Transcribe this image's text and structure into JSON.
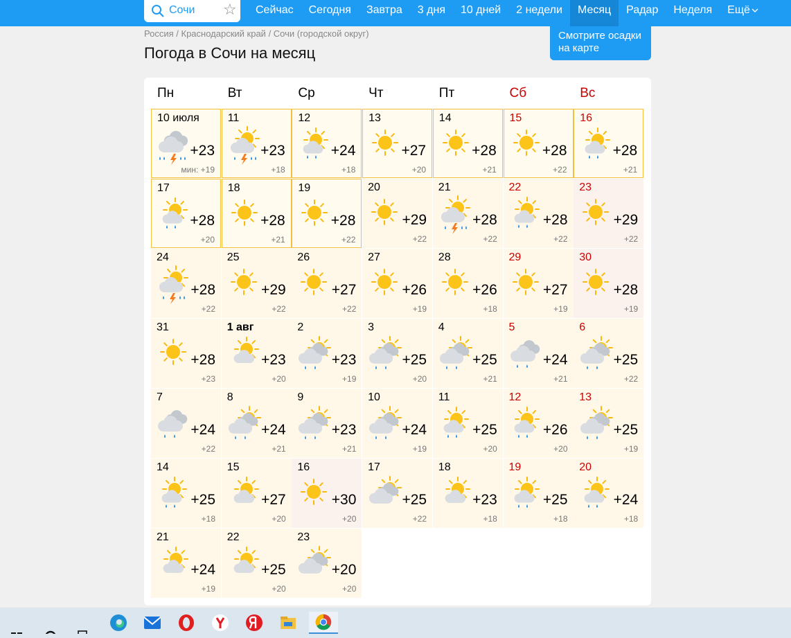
{
  "search": {
    "value": "Сочи"
  },
  "nav": {
    "items": [
      "Сейчас",
      "Сегодня",
      "Завтра",
      "3 дня",
      "10 дней",
      "2 недели",
      "Месяц",
      "Радар",
      "Неделя",
      "Ещё"
    ]
  },
  "promo": {
    "line1": "Смотрите осадки",
    "line2": "на карте"
  },
  "breadcrumbs": [
    "Россия",
    "Краснодарский край",
    "Сочи (городской округ)"
  ],
  "page_title": "Погода в Сочи на месяц",
  "weekdays": [
    "Пн",
    "Вт",
    "Ср",
    "Чт",
    "Пт",
    "Сб",
    "Вс"
  ],
  "min_prefix": "мин:",
  "days": [
    {
      "date": "10 июля",
      "icon": "cloud-thunder-rain-icon",
      "max": "+23",
      "min": "+19"
    },
    {
      "date": "11",
      "icon": "sun-cloud-thunder-rain-icon",
      "max": "+23",
      "min": "+18"
    },
    {
      "date": "12",
      "icon": "sun-cloud-rain-icon",
      "max": "+24",
      "min": "+18"
    },
    {
      "date": "13",
      "icon": "sun-icon",
      "max": "+27",
      "min": "+20"
    },
    {
      "date": "14",
      "icon": "sun-icon",
      "max": "+28",
      "min": "+21"
    },
    {
      "date": "15",
      "icon": "sun-icon",
      "max": "+28",
      "min": "+22"
    },
    {
      "date": "16",
      "icon": "sun-cloud-rain-icon",
      "max": "+28",
      "min": "+21"
    },
    {
      "date": "17",
      "icon": "sun-cloud-rain-icon",
      "max": "+28",
      "min": "+20"
    },
    {
      "date": "18",
      "icon": "sun-icon",
      "max": "+28",
      "min": "+21"
    },
    {
      "date": "19",
      "icon": "sun-icon",
      "max": "+28",
      "min": "+22"
    },
    {
      "date": "20",
      "icon": "sun-icon",
      "max": "+29",
      "min": "+22"
    },
    {
      "date": "21",
      "icon": "sun-cloud-thunder-rain-icon",
      "max": "+28",
      "min": "+22"
    },
    {
      "date": "22",
      "icon": "sun-cloud-rain-icon",
      "max": "+28",
      "min": "+22"
    },
    {
      "date": "23",
      "icon": "sun-icon",
      "max": "+29",
      "min": "+22"
    },
    {
      "date": "24",
      "icon": "sun-cloud-thunder-rain-icon",
      "max": "+28",
      "min": "+22"
    },
    {
      "date": "25",
      "icon": "sun-icon",
      "max": "+29",
      "min": "+22"
    },
    {
      "date": "26",
      "icon": "sun-icon",
      "max": "+27",
      "min": "+22"
    },
    {
      "date": "27",
      "icon": "sun-icon",
      "max": "+26",
      "min": "+19"
    },
    {
      "date": "28",
      "icon": "sun-icon",
      "max": "+26",
      "min": "+18"
    },
    {
      "date": "29",
      "icon": "sun-icon",
      "max": "+27",
      "min": "+19"
    },
    {
      "date": "30",
      "icon": "sun-icon",
      "max": "+28",
      "min": "+19"
    },
    {
      "date": "31",
      "icon": "sun-icon",
      "max": "+28",
      "min": "+23"
    },
    {
      "date": "1 авг",
      "icon": "sun-cloud-icon",
      "max": "+23",
      "min": "+20"
    },
    {
      "date": "2",
      "icon": "sun-clouds-rain-icon",
      "max": "+23",
      "min": "+19"
    },
    {
      "date": "3",
      "icon": "sun-clouds-rain-icon",
      "max": "+25",
      "min": "+20"
    },
    {
      "date": "4",
      "icon": "sun-clouds-rain-icon",
      "max": "+25",
      "min": "+21"
    },
    {
      "date": "5",
      "icon": "clouds-rain-icon",
      "max": "+24",
      "min": "+21"
    },
    {
      "date": "6",
      "icon": "sun-clouds-rain-icon",
      "max": "+25",
      "min": "+22"
    },
    {
      "date": "7",
      "icon": "clouds-rain-icon",
      "max": "+24",
      "min": "+22"
    },
    {
      "date": "8",
      "icon": "sun-clouds-rain-icon",
      "max": "+24",
      "min": "+21"
    },
    {
      "date": "9",
      "icon": "sun-clouds-rain-icon",
      "max": "+23",
      "min": "+21"
    },
    {
      "date": "10",
      "icon": "sun-clouds-rain-icon",
      "max": "+24",
      "min": "+19"
    },
    {
      "date": "11",
      "icon": "sun-cloud-rain-icon",
      "max": "+25",
      "min": "+20"
    },
    {
      "date": "12",
      "icon": "sun-cloud-rain-icon",
      "max": "+26",
      "min": "+20"
    },
    {
      "date": "13",
      "icon": "sun-clouds-rain-icon",
      "max": "+25",
      "min": "+19"
    },
    {
      "date": "14",
      "icon": "sun-cloud-rain-icon",
      "max": "+25",
      "min": "+18"
    },
    {
      "date": "15",
      "icon": "sun-cloud-icon",
      "max": "+27",
      "min": "+20"
    },
    {
      "date": "16",
      "icon": "sun-icon",
      "max": "+30",
      "min": "+20"
    },
    {
      "date": "17",
      "icon": "sun-clouds-icon",
      "max": "+25",
      "min": "+22"
    },
    {
      "date": "18",
      "icon": "sun-cloud-icon",
      "max": "+23",
      "min": "+18"
    },
    {
      "date": "19",
      "icon": "sun-cloud-rain-icon",
      "max": "+25",
      "min": "+18"
    },
    {
      "date": "20",
      "icon": "sun-cloud-rain-icon",
      "max": "+24",
      "min": "+18"
    },
    {
      "date": "21",
      "icon": "sun-cloud-icon",
      "max": "+24",
      "min": "+19"
    },
    {
      "date": "22",
      "icon": "sun-cloud-icon",
      "max": "+25",
      "min": "+20"
    },
    {
      "date": "23",
      "icon": "sun-clouds-icon",
      "max": "+20",
      "min": "+20"
    }
  ],
  "taskbar": {
    "apps": [
      "windows-start-icon",
      "search-icon",
      "task-view-icon",
      "edge-browser-icon",
      "mail-icon",
      "opera-browser-icon",
      "yandex-browser-icon",
      "yandex-icon",
      "file-explorer-icon",
      "chrome-browser-icon"
    ]
  },
  "colors": {
    "accent": "#1e9cf3",
    "weekend": "#cc0000",
    "highlight_border": "#f4be3f"
  }
}
